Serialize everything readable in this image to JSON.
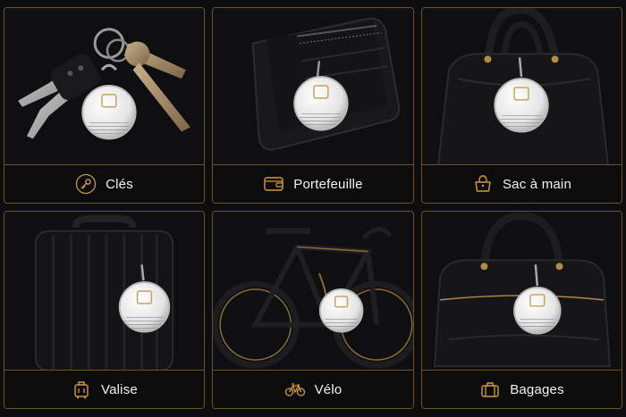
{
  "accent_color": "#d39a3a",
  "tiles": [
    {
      "label": "Clés",
      "icon": "key-icon",
      "scene": "keys"
    },
    {
      "label": "Portefeuille",
      "icon": "wallet-icon",
      "scene": "wallet"
    },
    {
      "label": "Sac à main",
      "icon": "handbag-icon",
      "scene": "handbag"
    },
    {
      "label": "Valise",
      "icon": "suitcase-icon",
      "scene": "suitcase"
    },
    {
      "label": "Vélo",
      "icon": "bicycle-icon",
      "scene": "bicycle"
    },
    {
      "label": "Bagages",
      "icon": "luggage-icon",
      "scene": "luggage"
    }
  ]
}
